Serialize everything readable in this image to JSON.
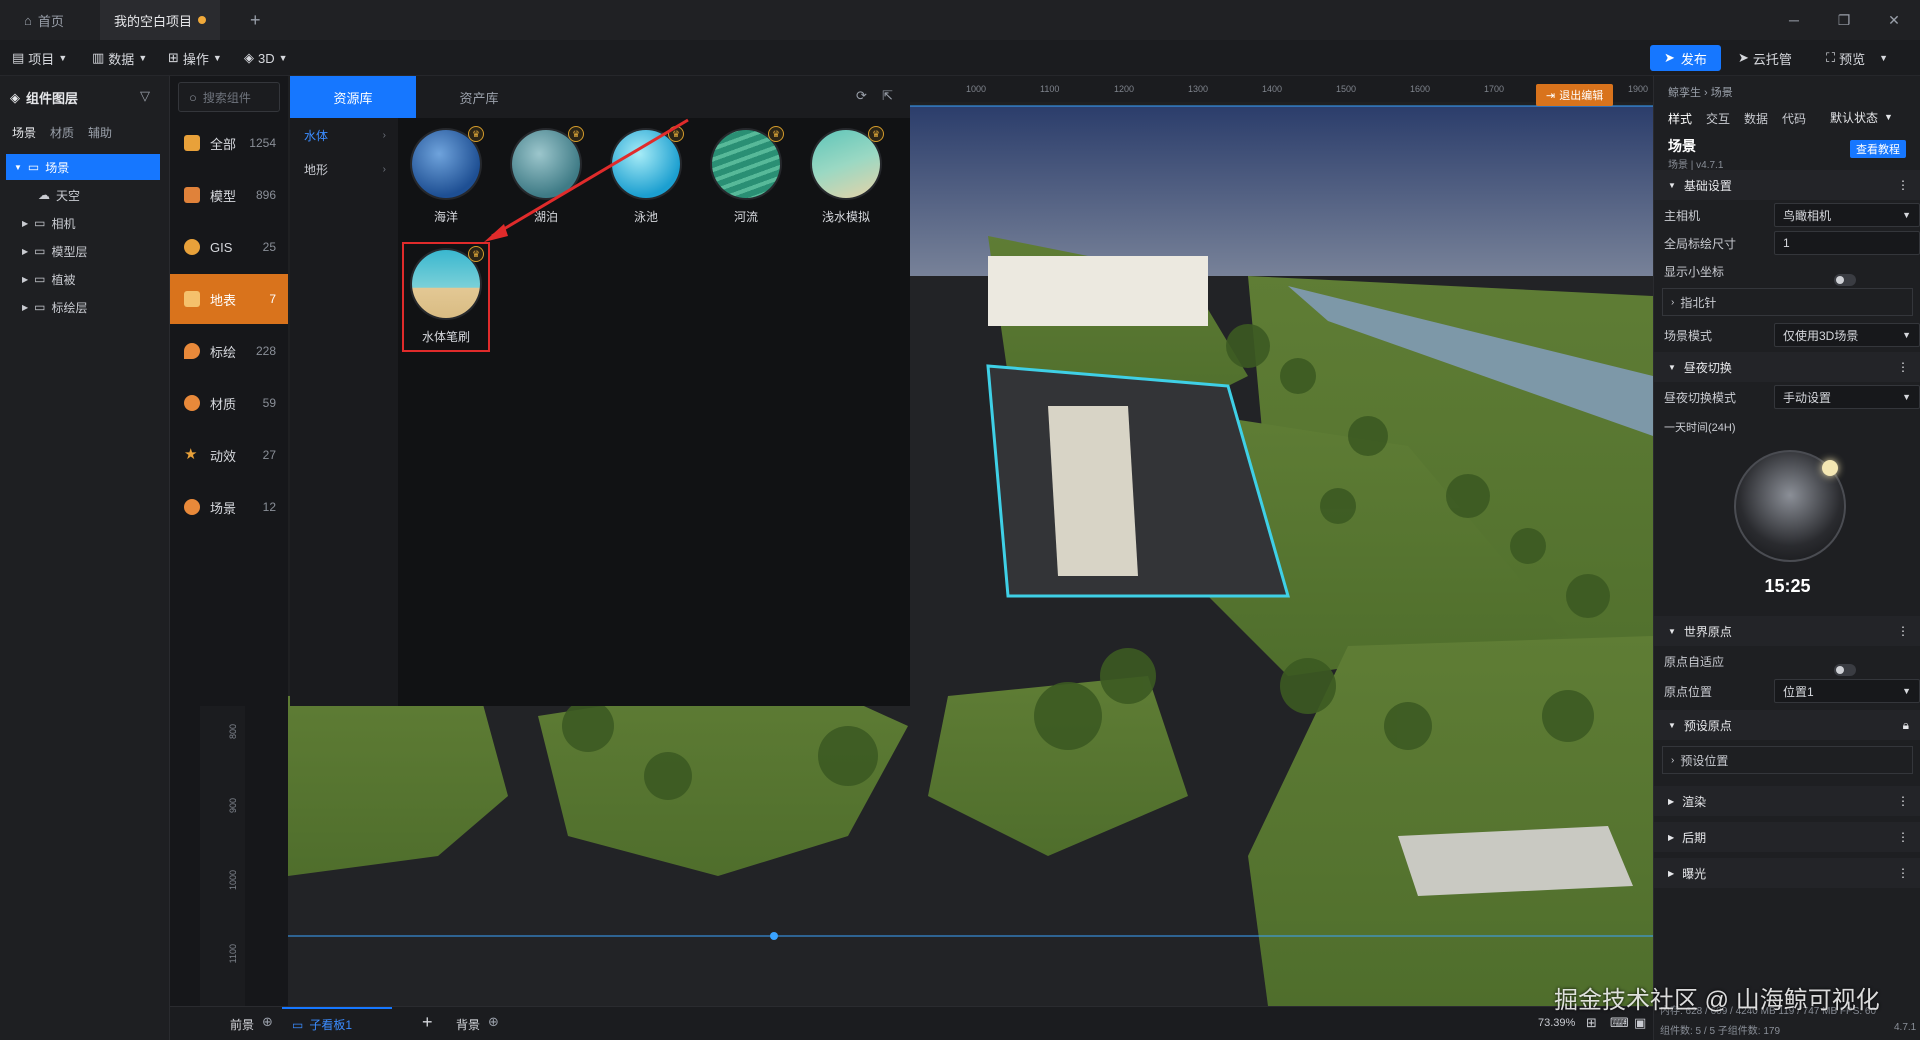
{
  "titlebar": {
    "tabs": [
      {
        "label": "首页"
      },
      {
        "label": "我的空白项目"
      }
    ],
    "add_tab": "+"
  },
  "menubar": {
    "items": [
      "项目",
      "数据",
      "操作",
      "3D"
    ],
    "publish": "发布",
    "cloud": "云托管",
    "preview": "预览"
  },
  "left_panel": {
    "title": "组件图层",
    "tabs": [
      "场景",
      "材质",
      "辅助"
    ],
    "tree": [
      "场景",
      "天空",
      "相机",
      "模型层",
      "植被",
      "标绘层"
    ]
  },
  "categories": [
    {
      "label": "全部",
      "count": "1254",
      "color": "#e8a13a"
    },
    {
      "label": "模型",
      "count": "896",
      "color": "#e0823a"
    },
    {
      "label": "GIS",
      "count": "25",
      "color": "#e8a13a"
    },
    {
      "label": "地表",
      "count": "7",
      "color": "#f5c16c"
    },
    {
      "label": "标绘",
      "count": "228",
      "color": "#e8893a"
    },
    {
      "label": "材质",
      "count": "59",
      "color": "#e8893a"
    },
    {
      "label": "动效",
      "count": "27",
      "color": "#e8a13a"
    },
    {
      "label": "场景",
      "count": "12",
      "color": "#e8893a"
    }
  ],
  "resource": {
    "search_placeholder": "搜索组件",
    "tabs": [
      "资源库",
      "资产库"
    ],
    "subcategories": [
      "水体",
      "地形"
    ],
    "items": [
      {
        "label": "海洋"
      },
      {
        "label": "湖泊"
      },
      {
        "label": "泳池"
      },
      {
        "label": "河流"
      },
      {
        "label": "浅水模拟"
      },
      {
        "label": "水体笔刷"
      }
    ]
  },
  "viewport": {
    "exit_edit": "退出编辑",
    "ruler_top": [
      "1000",
      "1100",
      "1200",
      "1300",
      "1400",
      "1500",
      "1600",
      "1700",
      "1900"
    ],
    "ruler_left": [
      "800",
      "900",
      "1000",
      "1100"
    ]
  },
  "right_panel": {
    "breadcrumb": "鲸孪生 › 场景",
    "tabs": [
      "样式",
      "交互",
      "数据",
      "代码"
    ],
    "state_select": "默认状态",
    "title": "场景",
    "version": "场景 | v4.7.1",
    "tutorial": "查看教程",
    "sections": {
      "basic": "基础设置",
      "day_night": "昼夜切换",
      "world_origin": "世界原点",
      "preset_origin": "预设原点",
      "render": "渲染",
      "post": "后期",
      "exposure": "曝光"
    },
    "fields": {
      "main_camera_label": "主相机",
      "main_camera_value": "鸟瞰相机",
      "plot_size_label": "全局标绘尺寸",
      "plot_size_value": "1",
      "show_axis_label": "显示小坐标",
      "compass_label": "指北针",
      "scene_mode_label": "场景模式",
      "scene_mode_value": "仅使用3D场景",
      "day_mode_label": "昼夜切换模式",
      "day_mode_value": "手动设置",
      "day_time_label": "一天时间(24H)",
      "day_time_value": "15:25",
      "origin_auto_label": "原点自适应",
      "origin_pos_label": "原点位置",
      "origin_pos_value": "位置1",
      "preset_position": "预设位置"
    }
  },
  "bottom": {
    "front": "前景",
    "sub_view": "子看板1",
    "back": "背景",
    "zoom": "73.39%",
    "status_line1": "内存: 628 / 609 / 4240 MB  119 / 747 MB  FPS: 60",
    "status_line2": "组件数: 5 / 5   子组件数: 179",
    "version": "4.7.1"
  },
  "watermark": "掘金技术社区 @ 山海鲸可视化",
  "colors": {
    "accent": "#1677ff",
    "category_selected": "#d9731c",
    "highlight": "#e02b2b"
  }
}
